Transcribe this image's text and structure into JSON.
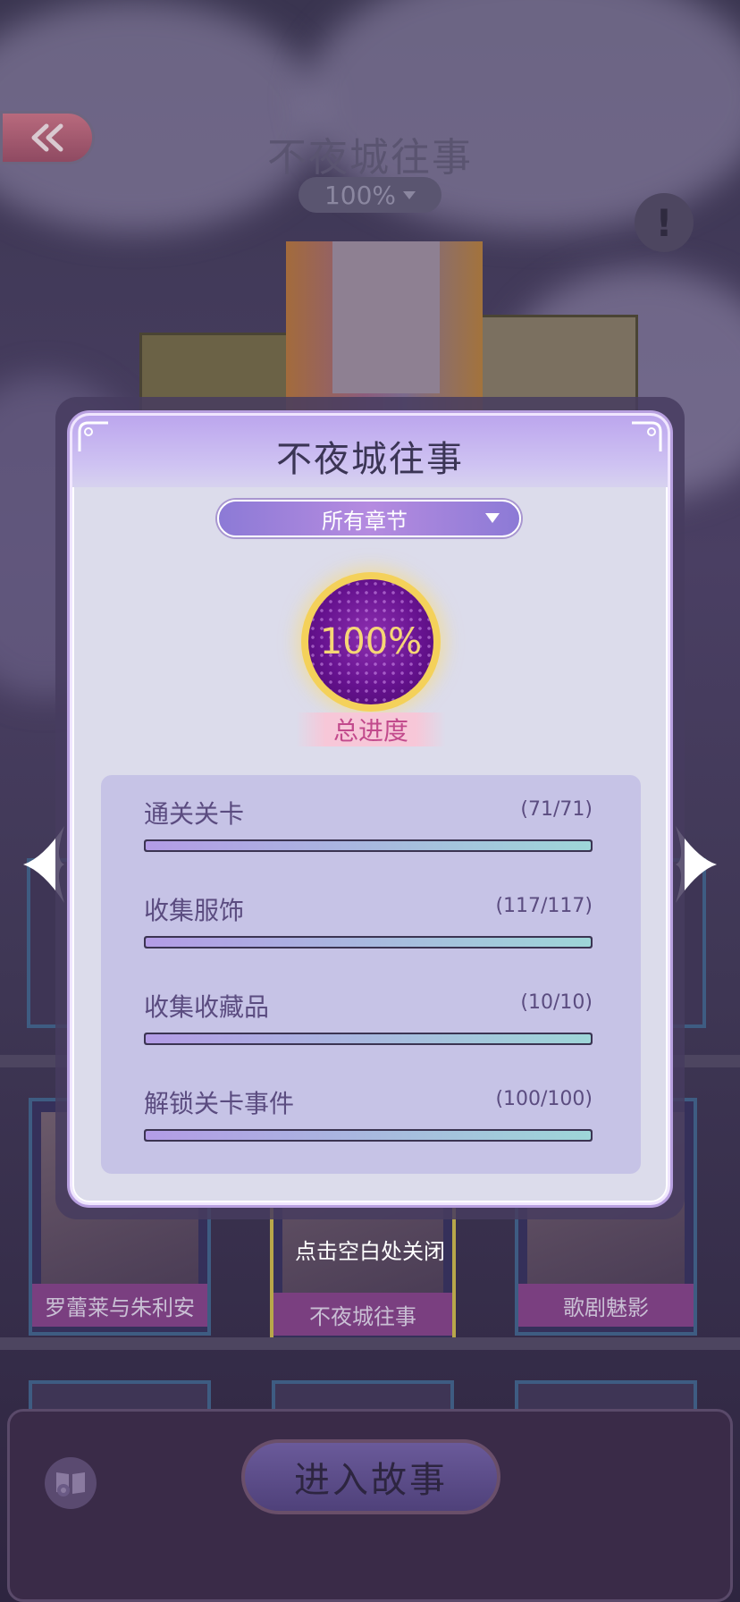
{
  "background": {
    "story_title": "不夜城往事",
    "story_progress": "100%",
    "books": [
      {
        "title": "罗蕾莱与朱利安"
      },
      {
        "title": "不夜城往事"
      },
      {
        "title": "歌剧魅影"
      }
    ],
    "close_hint": "点击空白处关闭",
    "enter_button": "进入故事"
  },
  "modal": {
    "title": "不夜城往事",
    "chapter_select": "所有章节",
    "total_progress_value": "100%",
    "total_progress_label": "总进度",
    "stats": [
      {
        "name": "通关关卡",
        "value": "(71/71)",
        "progress": 1.0
      },
      {
        "name": "收集服饰",
        "value": "(117/117)",
        "progress": 1.0
      },
      {
        "name": "收集收藏品",
        "value": "(10/10)",
        "progress": 1.0
      },
      {
        "name": "解锁关卡事件",
        "value": "(100/100)",
        "progress": 1.0
      }
    ]
  },
  "colors": {
    "accent_purple": "#bca6ee",
    "gold": "#f4d15a",
    "progress_start": "#b39ce6",
    "progress_end": "#9ed6d8"
  }
}
